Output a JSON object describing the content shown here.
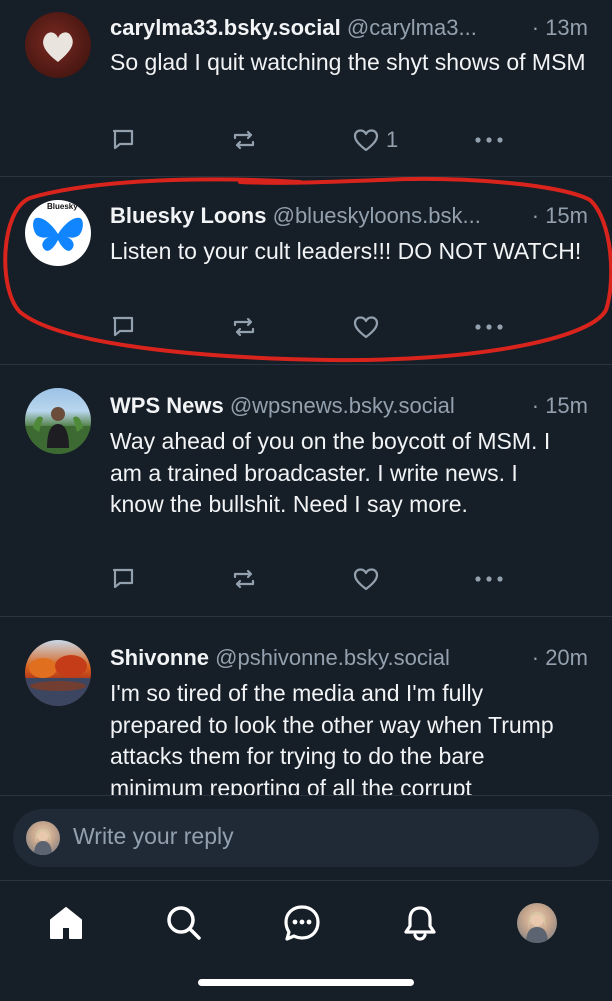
{
  "posts": [
    {
      "name": "carylma33.bsky.social",
      "handle": "@carylma3...",
      "time": "· 13m",
      "text": "So glad I quit watching the shyt shows of MSM",
      "like_count": "1",
      "avatar": "heart-stone-photo"
    },
    {
      "name": "Bluesky Loons",
      "handle": "@blueskyloons.bsk...",
      "time": "· 15m",
      "text": "Listen to your cult leaders!!! DO NOT WATCH!",
      "like_count": "",
      "avatar_label": "Bluesky"
    },
    {
      "name": "WPS News",
      "handle": "@wpsnews.bsky.social",
      "time": "· 15m",
      "text": "Way ahead of you on the boycott of MSM. I am a trained broadcaster. I write news. I know the bullshit. Need I say more.",
      "like_count": "",
      "avatar": "person-outdoors-photo"
    },
    {
      "name": "Shivonne",
      "handle": "@pshivonne.bsky.social",
      "time": "· 20m",
      "text": "I'm so tired of the media and I'm fully prepared to look the other way when Trump attacks them for trying to do the bare minimum reporting of all the corrupt",
      "avatar": "autumn-lake-photo"
    }
  ],
  "reply": {
    "placeholder": "Write your reply"
  },
  "tabs": [
    "home-icon",
    "search-icon",
    "chat-icon",
    "bell-icon",
    "profile-avatar"
  ],
  "colors": {
    "background": "#161e27",
    "text": "#f1f3f5",
    "muted": "#93a0ae",
    "annotation": "#d8241c",
    "brand_blue": "#1185fe"
  }
}
